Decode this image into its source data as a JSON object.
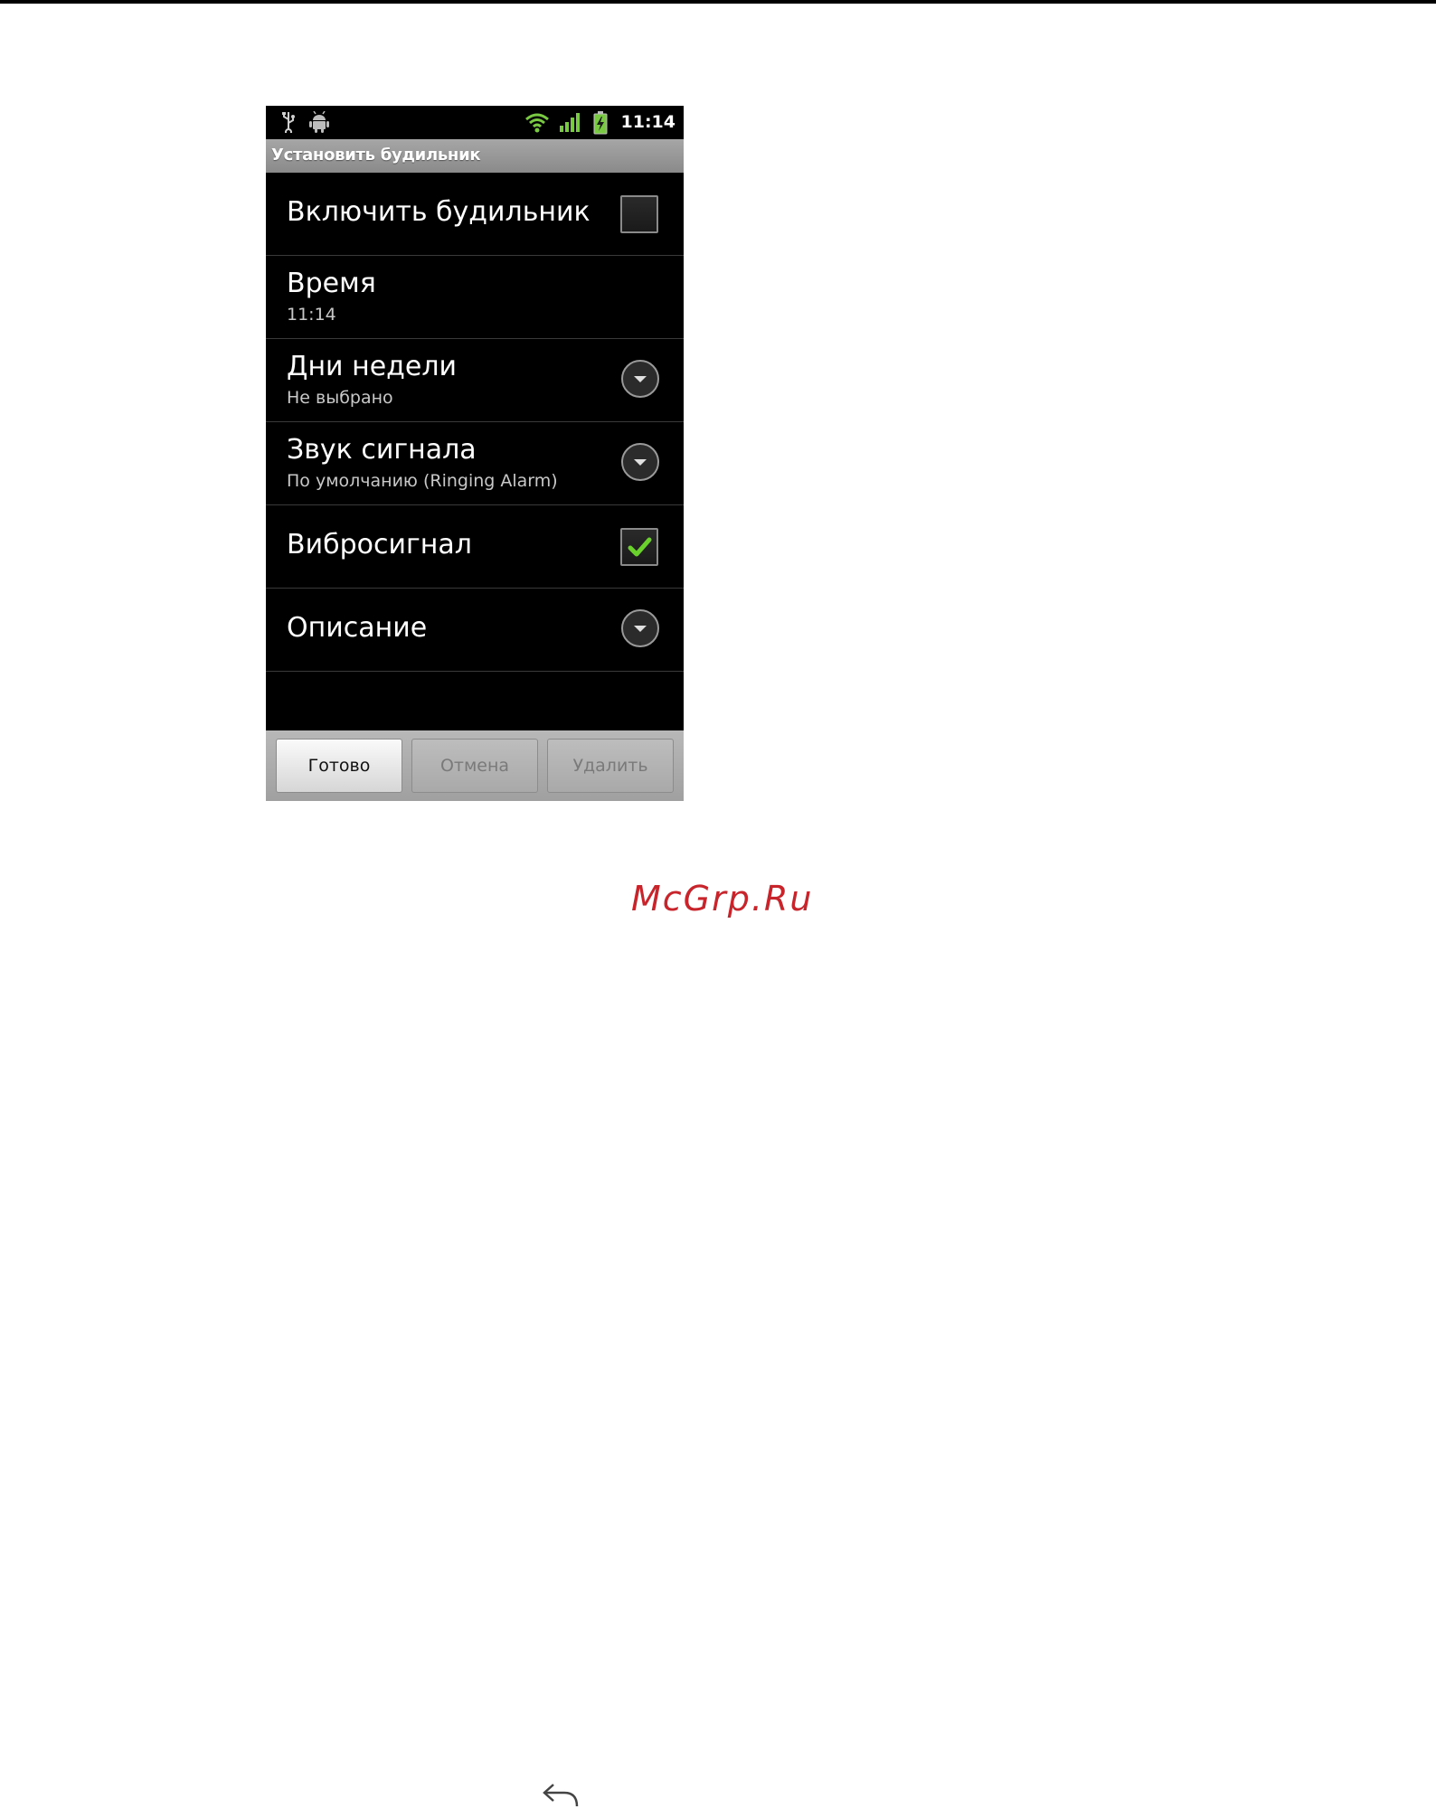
{
  "status_bar": {
    "time": "11:14",
    "icons": [
      "usb-icon",
      "android-debug-icon",
      "wifi-icon",
      "signal-icon",
      "battery-charging-icon"
    ]
  },
  "title_bar": {
    "title": "Установить будильник"
  },
  "settings": {
    "enable": {
      "label": "Включить будильник",
      "checked": false
    },
    "time": {
      "label": "Время",
      "value": "11:14"
    },
    "days": {
      "label": "Дни недели",
      "value": "Не выбрано"
    },
    "sound": {
      "label": "Звук сигнала",
      "value": "По умолчанию (Ringing Alarm)"
    },
    "vibrate": {
      "label": "Вибросигнал",
      "checked": true
    },
    "description": {
      "label": "Описание"
    }
  },
  "buttons": {
    "done": "Готово",
    "cancel": "Отмена",
    "delete": "Удалить"
  },
  "watermark": "McGrp.Ru",
  "colors": {
    "checkmark": "#6ad12c",
    "watermark": "#c8242b",
    "title_bar": "#9a9a9a"
  }
}
